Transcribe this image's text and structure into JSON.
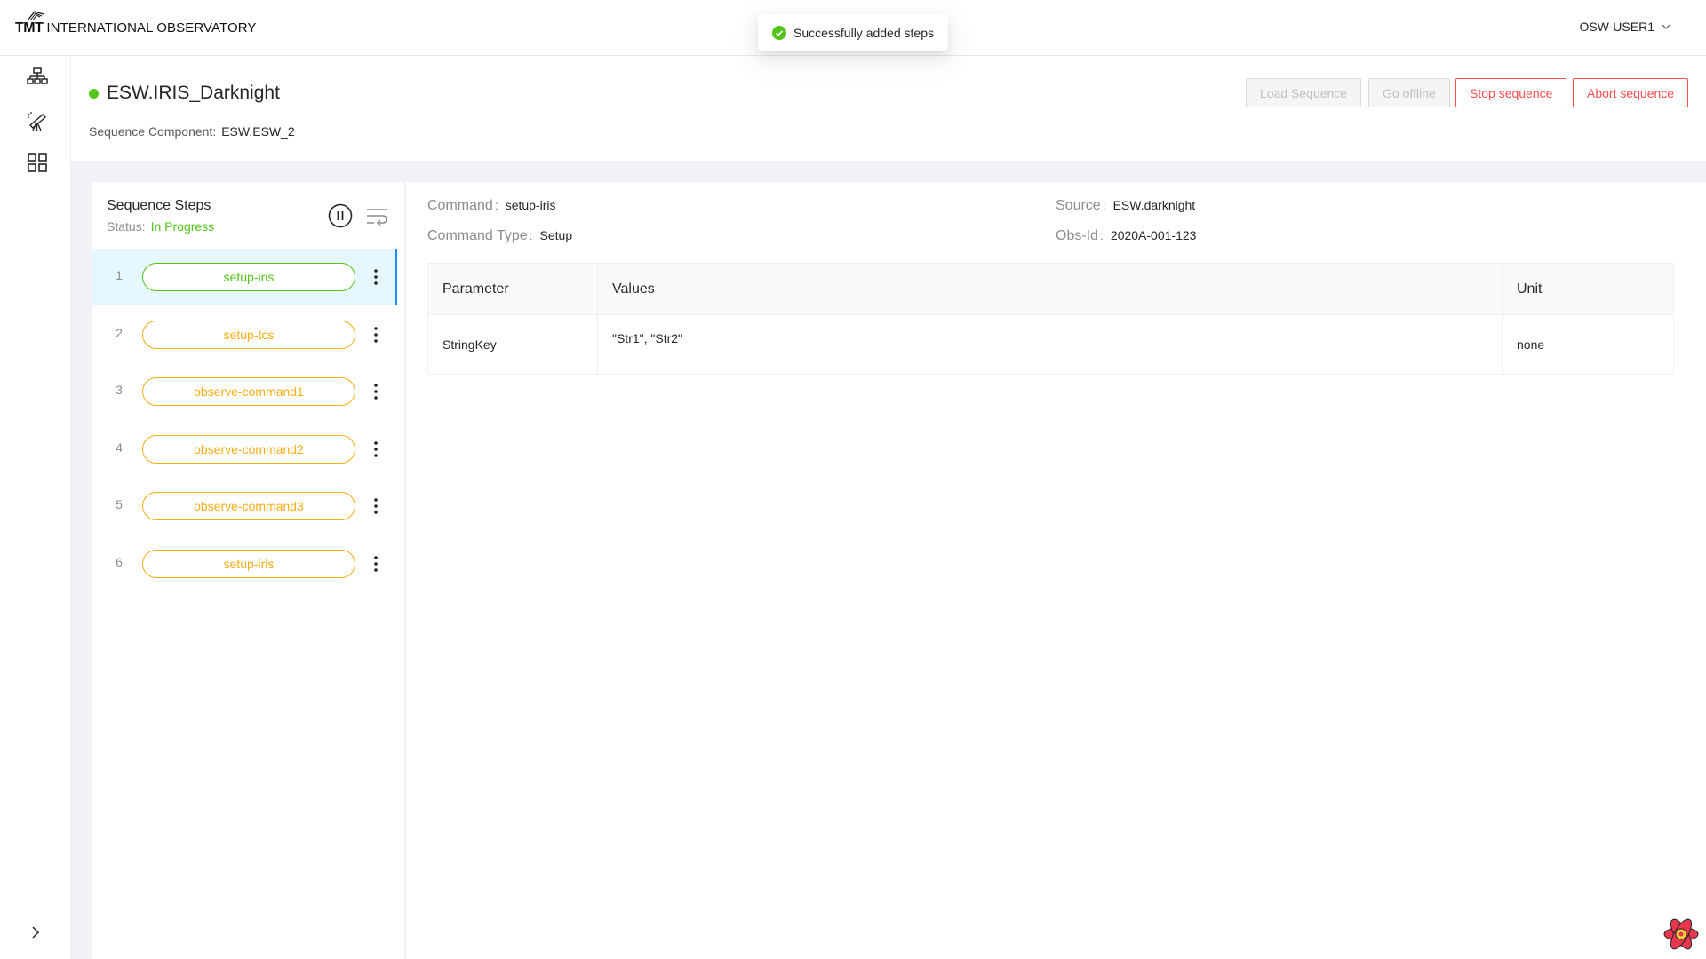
{
  "header": {
    "logo_mark": "TMT",
    "logo_text": "INTERNATIONAL OBSERVATORY",
    "user": "OSW-USER1"
  },
  "toast": {
    "message": "Successfully added steps",
    "icon": "check-circle-icon",
    "color": "#52c41a"
  },
  "sidenav": {
    "icons": [
      "hierarchy-icon",
      "telescope-icon",
      "grid-icon"
    ],
    "expand_icon": "chevron-right-icon"
  },
  "sequencer": {
    "status_color": "#52c41a",
    "title": "ESW.IRIS_Darknight",
    "component_label": "Sequence Component:",
    "component_value": "ESW.ESW_2"
  },
  "actions": {
    "load_sequence": "Load Sequence",
    "go_offline": "Go offline",
    "stop_sequence": "Stop sequence",
    "abort_sequence": "Abort sequence"
  },
  "steps_panel": {
    "title": "Sequence Steps",
    "status_label": "Status:",
    "status_value": "In Progress",
    "pause_icon": "pause-circle-icon",
    "reload_icon": "wrap-lines-icon",
    "steps": [
      {
        "num": "1",
        "name": "setup-iris",
        "state": "in-progress",
        "color": "#52c41a"
      },
      {
        "num": "2",
        "name": "setup-tcs",
        "state": "pending",
        "color": "#faad14"
      },
      {
        "num": "3",
        "name": "observe-command1",
        "state": "pending",
        "color": "#faad14"
      },
      {
        "num": "4",
        "name": "observe-command2",
        "state": "pending",
        "color": "#faad14"
      },
      {
        "num": "5",
        "name": "observe-command3",
        "state": "pending",
        "color": "#faad14"
      },
      {
        "num": "6",
        "name": "setup-iris",
        "state": "pending",
        "color": "#faad14"
      }
    ]
  },
  "details": {
    "command_label": "Command",
    "command_value": "setup-iris",
    "command_type_label": "Command Type",
    "command_type_value": "Setup",
    "source_label": "Source",
    "source_value": "ESW.darknight",
    "obs_id_label": "Obs-Id",
    "obs_id_value": "2020A-001-123",
    "table": {
      "headers": [
        "Parameter",
        "Values",
        "Unit"
      ],
      "rows": [
        {
          "parameter": "StringKey",
          "values": "\"Str1\", \"Str2\"",
          "unit": "none"
        }
      ]
    }
  }
}
